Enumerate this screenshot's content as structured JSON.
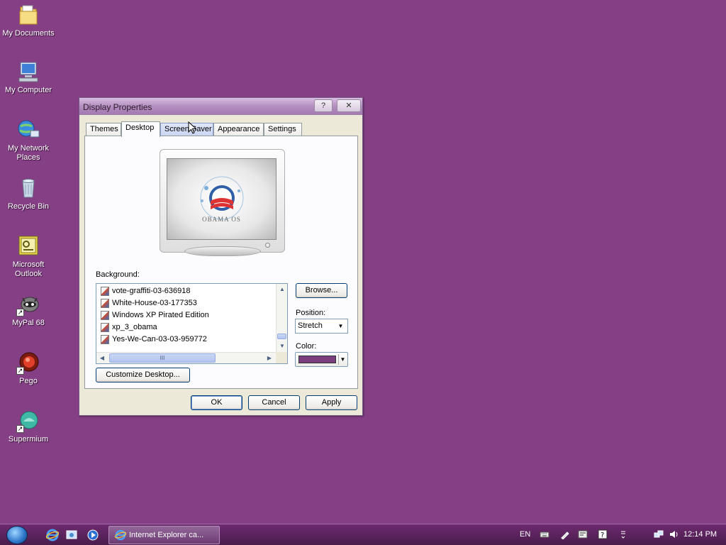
{
  "desktop": {
    "icons": [
      {
        "label": "My Documents"
      },
      {
        "label": "My Computer"
      },
      {
        "label": "My Network Places"
      },
      {
        "label": "Recycle Bin"
      },
      {
        "label": "Microsoft Outlook"
      },
      {
        "label": "MyPal 68"
      },
      {
        "label": "Pego"
      },
      {
        "label": "Supermium"
      }
    ],
    "background_color": "#843f85"
  },
  "dialog": {
    "title": "Display Properties",
    "help_label": "?",
    "close_label": "✕",
    "tabs": [
      {
        "label": "Themes"
      },
      {
        "label": "Desktop"
      },
      {
        "label": "Screen Saver"
      },
      {
        "label": "Appearance"
      },
      {
        "label": "Settings"
      }
    ],
    "active_tab": "Desktop",
    "preview_text": "OBAMA OS",
    "background_label": "Background:",
    "backgrounds": [
      {
        "name": "vote-graffiti-03-636918"
      },
      {
        "name": "White-House-03-177353"
      },
      {
        "name": "Windows XP Pirated Edition"
      },
      {
        "name": "xp_3_obama"
      },
      {
        "name": "Yes-We-Can-03-03-959772"
      }
    ],
    "hscroll_grip": "III",
    "browse_label": "Browse...",
    "position_label": "Position:",
    "position_value": "Stretch",
    "color_label": "Color:",
    "color_value": "#7b3f7f",
    "customize_label": "Customize Desktop...",
    "ok_label": "OK",
    "cancel_label": "Cancel",
    "apply_label": "Apply"
  },
  "taskbar": {
    "task_label": "Internet Explorer ca...",
    "language": "EN",
    "clock": "12:14 PM"
  }
}
